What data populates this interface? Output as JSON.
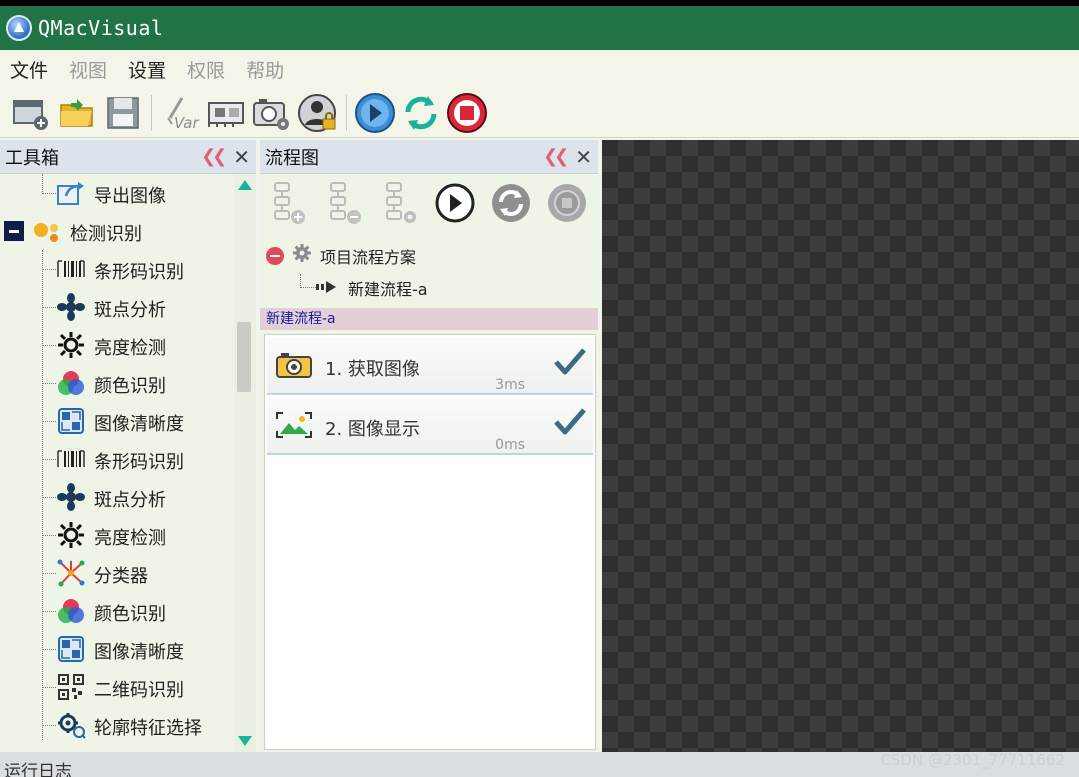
{
  "window": {
    "title": "QMacVisual"
  },
  "menu": [
    {
      "label": "文件",
      "enabled": true
    },
    {
      "label": "视图",
      "enabled": false
    },
    {
      "label": "设置",
      "enabled": true
    },
    {
      "label": "权限",
      "enabled": false
    },
    {
      "label": "帮助",
      "enabled": false
    }
  ],
  "toolbar": {
    "buttons": [
      "new-project-icon",
      "open-folder-icon",
      "save-icon",
      "variable-icon",
      "device-card-icon",
      "camera-settings-icon",
      "user-lock-icon",
      "run-icon",
      "loop-run-icon",
      "stop-icon"
    ]
  },
  "toolbox": {
    "title": "工具箱",
    "group_label": "检测识别",
    "items": [
      {
        "label": "导出图像",
        "icon": "export-image-icon"
      },
      {
        "label": "条形码识别",
        "icon": "barcode-icon"
      },
      {
        "label": "斑点分析",
        "icon": "blob-icon"
      },
      {
        "label": "亮度检测",
        "icon": "brightness-icon"
      },
      {
        "label": "颜色识别",
        "icon": "color-icon"
      },
      {
        "label": "图像清晰度",
        "icon": "sharpness-icon"
      },
      {
        "label": "条形码识别",
        "icon": "barcode-icon"
      },
      {
        "label": "斑点分析",
        "icon": "blob-icon"
      },
      {
        "label": "亮度检测",
        "icon": "brightness-icon"
      },
      {
        "label": "分类器",
        "icon": "classifier-icon"
      },
      {
        "label": "颜色识别",
        "icon": "color-icon"
      },
      {
        "label": "图像清晰度",
        "icon": "sharpness-icon"
      },
      {
        "label": "二维码识别",
        "icon": "qrcode-icon"
      },
      {
        "label": "轮廓特征选择",
        "icon": "contour-icon"
      }
    ]
  },
  "flow": {
    "title": "流程图",
    "project_label": "项目流程方案",
    "flow_name": "新建流程-a",
    "current_flow": "新建流程-a",
    "steps": [
      {
        "label": "1. 获取图像",
        "time": "3ms",
        "icon": "camera-icon"
      },
      {
        "label": "2. 图像显示",
        "time": "0ms",
        "icon": "image-display-icon"
      }
    ]
  },
  "status": {
    "log_label": "运行日志"
  },
  "watermark": "CSDN @2301_77711662",
  "colors": {
    "titlebar": "#217346",
    "accent_teal": "#19b39c",
    "stop_red": "#d9263a"
  }
}
